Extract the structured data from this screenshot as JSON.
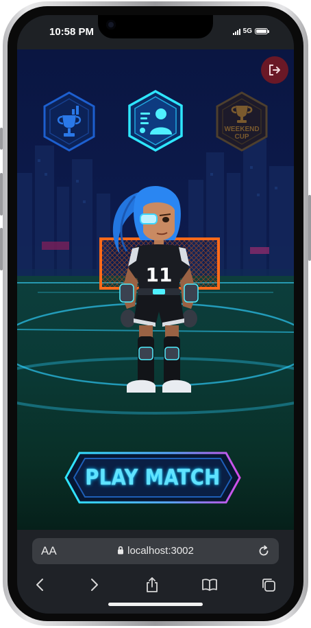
{
  "status_bar": {
    "time": "10:58 PM",
    "network": "5G"
  },
  "game": {
    "menu_badges": [
      {
        "name": "leaderboard",
        "icon": "trophy-bar-chart-icon",
        "active": false
      },
      {
        "name": "profile",
        "icon": "player-profile-icon",
        "active": true
      },
      {
        "name": "weekend-cup",
        "icon": "cup-icon",
        "label_line1": "WEEKEND",
        "label_line2": "CUP",
        "active": false
      }
    ],
    "exit_icon": "logout-icon",
    "player": {
      "jersey_number": "11"
    },
    "play_button": {
      "label": "PLAY MATCH"
    },
    "colors": {
      "accent": "#2ee6ff",
      "magenta": "#d44be8",
      "goal": "#ff6a1a",
      "exit": "#6a1826"
    }
  },
  "browser": {
    "text_size_label": "AA",
    "url": "localhost:3002",
    "icons": {
      "lock": "lock-icon",
      "reload": "reload-icon",
      "back": "back-chevron-icon",
      "forward": "forward-chevron-icon",
      "share": "share-icon",
      "bookmarks": "bookmarks-icon",
      "tabs": "tabs-icon"
    }
  }
}
